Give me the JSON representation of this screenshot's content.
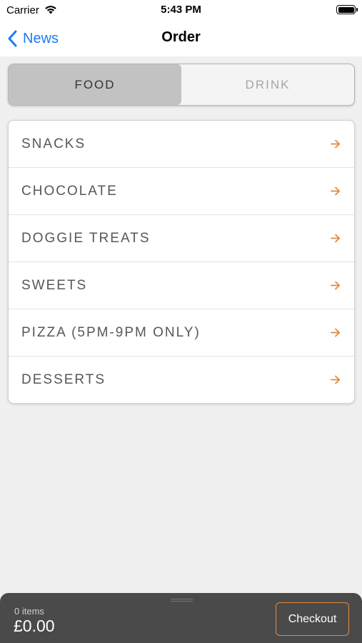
{
  "status_bar": {
    "carrier": "Carrier",
    "time": "5:43 PM"
  },
  "nav": {
    "back_label": "News",
    "title": "Order"
  },
  "segments": [
    {
      "label": "FOOD",
      "selected": true
    },
    {
      "label": "DRINK",
      "selected": false
    }
  ],
  "categories": [
    {
      "label": "SNACKS"
    },
    {
      "label": "CHOCOLATE"
    },
    {
      "label": "DOGGIE TREATS"
    },
    {
      "label": "SWEETS"
    },
    {
      "label": "PIZZA (5PM-9PM ONLY)"
    },
    {
      "label": "DESSERTS"
    }
  ],
  "cart": {
    "item_count": "0 items",
    "total": "£0.00",
    "checkout_label": "Checkout"
  },
  "colors": {
    "accent": "#e38a3c",
    "link": "#1a7cf5",
    "cart_background": "#4a4a4a",
    "page_background": "#f0f0f0"
  },
  "icons": {
    "wifi": "wifi-icon",
    "battery": "battery-icon",
    "back": "chevron-left-icon",
    "row_arrow": "arrow-right-icon"
  }
}
